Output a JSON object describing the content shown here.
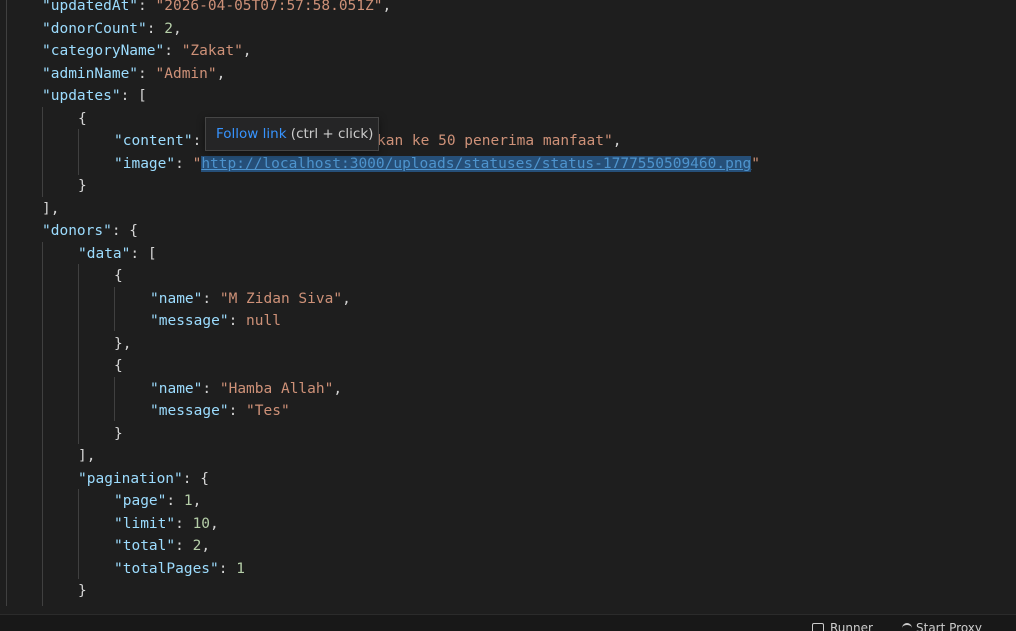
{
  "tooltip": {
    "link_text": "Follow link",
    "hint": " (ctrl + click)"
  },
  "json": {
    "updatedAt_key": "\"updatedAt\"",
    "updatedAt_value": "\"2026-04-05T07:57:58.051Z\"",
    "donorCount_key": "\"donorCount\"",
    "donorCount_value": "2",
    "categoryName_key": "\"categoryName\"",
    "categoryName_value": "\"Zakat\"",
    "adminName_key": "\"adminName\"",
    "adminName_value": "\"Admin\"",
    "updates_key": "\"updates\"",
    "content_key": "\"content\"",
    "content_value_visible": "kan ke 50 penerima manfaat\"",
    "image_key": "\"image\"",
    "image_url": "http://localhost:3000/uploads/statuses/status-1777550509460.png",
    "donors_key": "\"donors\"",
    "data_key": "\"data\"",
    "donor1_name_key": "\"name\"",
    "donor1_name_value": "\"M Zidan Siva\"",
    "donor1_message_key": "\"message\"",
    "donor1_message_value": "null",
    "donor2_name_key": "\"name\"",
    "donor2_name_value": "\"Hamba Allah\"",
    "donor2_message_key": "\"message\"",
    "donor2_message_value": "\"Tes\"",
    "pagination_key": "\"pagination\"",
    "page_key": "\"page\"",
    "page_value": "1",
    "limit_key": "\"limit\"",
    "limit_value": "10",
    "total_key": "\"total\"",
    "total_value": "2",
    "totalPages_key": "\"totalPages\"",
    "totalPages_value": "1"
  },
  "statusbar": {
    "runner": "Runner",
    "start_proxy": "Start Proxy"
  }
}
